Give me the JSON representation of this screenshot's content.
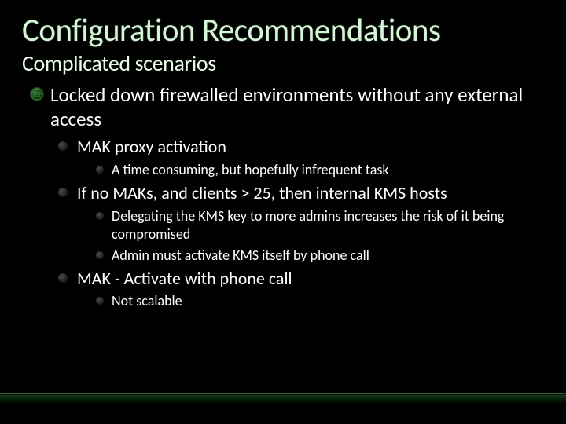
{
  "title": "Configuration Recommendations",
  "subtitle": "Complicated scenarios",
  "lvl1_text": "Locked down firewalled environments without any external access",
  "lvl2": [
    {
      "text": "MAK proxy activation",
      "children": [
        "A time consuming, but hopefully infrequent task"
      ]
    },
    {
      "text": "If no MAKs, and clients > 25, then internal KMS hosts",
      "children": [
        "Delegating the KMS  key to more admins increases the risk of it being compromised",
        "Admin must activate KMS itself by phone call"
      ]
    },
    {
      "text": "MAK - Activate with phone call",
      "children": [
        "Not scalable"
      ]
    }
  ]
}
